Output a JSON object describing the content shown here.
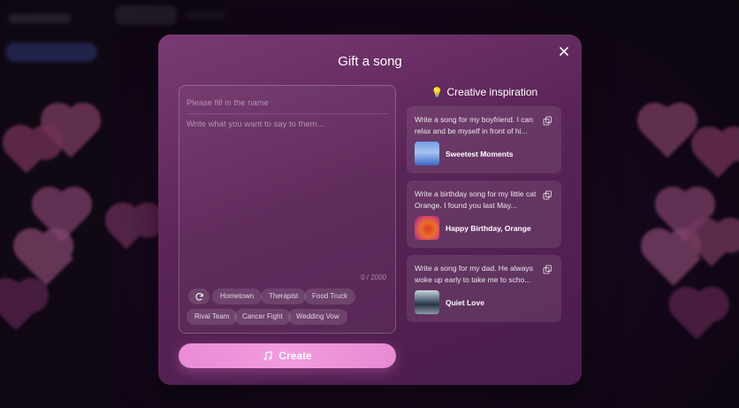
{
  "modal": {
    "title": "Gift a song",
    "close_icon": "close-icon"
  },
  "form": {
    "name_placeholder": "Please fill in the name",
    "message_placeholder": "Write what you want to say to them...",
    "counter": "0 / 2000",
    "chips": [
      "Hometown",
      "Therapist",
      "Food Truck",
      "Rival Team",
      "Cancer Fight",
      "Wedding Vow"
    ],
    "refresh_icon": "refresh-icon",
    "create_label": "Create",
    "create_icon": "music-note-icon"
  },
  "inspiration": {
    "title": "Creative inspiration",
    "title_icon": "lightbulb-icon",
    "cards": [
      {
        "text": "Write a song for my boyfriend. I can relax and be myself in front of hi...",
        "song": "Sweetest Moments",
        "copy_icon": "copy-icon"
      },
      {
        "text": "Write a birthday song for my little cat Orange. I found you last May...",
        "song": "Happy Birthday, Orange",
        "copy_icon": "copy-icon"
      },
      {
        "text": "Write a song for my dad. He always woke up early to take me to scho...",
        "song": "Quiet Love",
        "copy_icon": "copy-icon"
      }
    ]
  },
  "colors": {
    "modal_top": "#7a3a73",
    "modal_bottom": "#4a1c4c",
    "create_button": "#f39bdf",
    "heart": "#e46aa6"
  }
}
